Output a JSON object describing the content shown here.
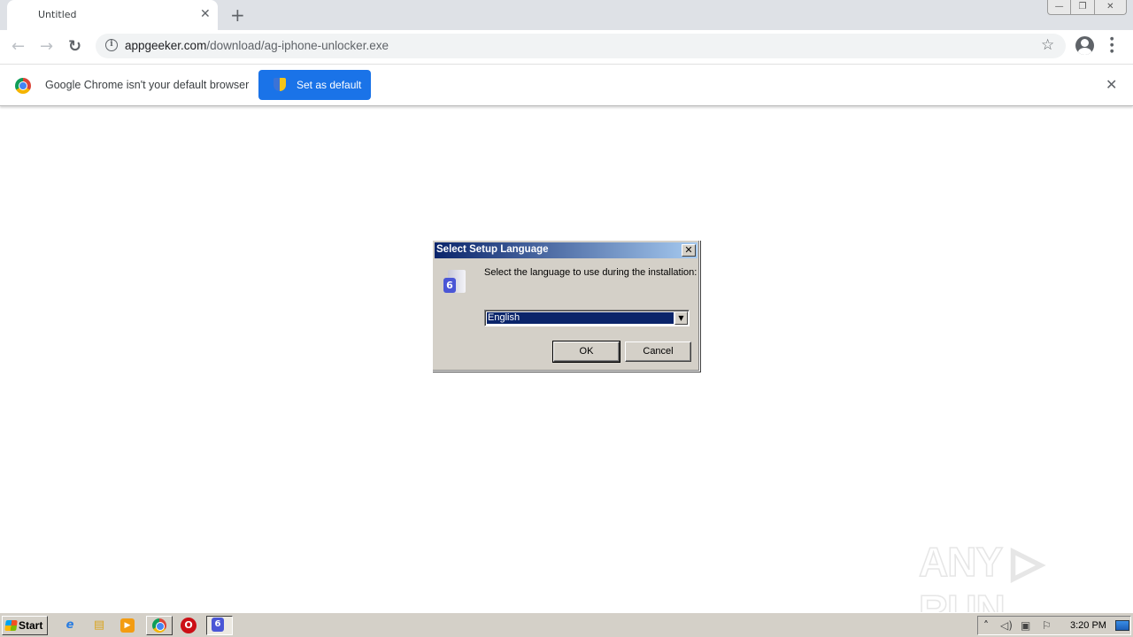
{
  "browser": {
    "tab": {
      "title": "Untitled",
      "close_icon": "close-icon"
    },
    "new_tab_icon": "plus-icon",
    "window_controls": {
      "minimize": "—",
      "restore": "❐",
      "close": "✕"
    },
    "toolbar": {
      "back_icon": "←",
      "forward_icon": "→",
      "reload_icon": "↻",
      "info_icon": "i",
      "url_host": "appgeeker.com",
      "url_path": "/download/ag-iphone-unlocker.exe",
      "bookmark_icon": "☆",
      "menu_icon": "⋮"
    },
    "infobar": {
      "message": "Google Chrome isn't your default browser",
      "button_label": "Set as default",
      "button_color": "#1a73e8",
      "close_icon": "✕"
    }
  },
  "dialog": {
    "title": "Select Setup Language",
    "close_icon": "✕",
    "prompt": "Select the language to use during the installation:",
    "language_selected": "English",
    "dropdown_arrow": "▼",
    "ok_label": "OK",
    "cancel_label": "Cancel",
    "icon_badge": "6"
  },
  "watermark": {
    "text": "ANY ▷ RUN"
  },
  "taskbar": {
    "start_label": "Start",
    "apps": [
      "internet-explorer",
      "file-explorer",
      "media-player",
      "chrome",
      "opera",
      "setup"
    ],
    "app_glyphs": [
      "e",
      "▤",
      "▶",
      "◉",
      "O",
      "6"
    ],
    "tray": {
      "expand": "˄",
      "volume": "🔊",
      "network": "▣",
      "flag": "⚐"
    },
    "clock": "3:20 PM"
  }
}
